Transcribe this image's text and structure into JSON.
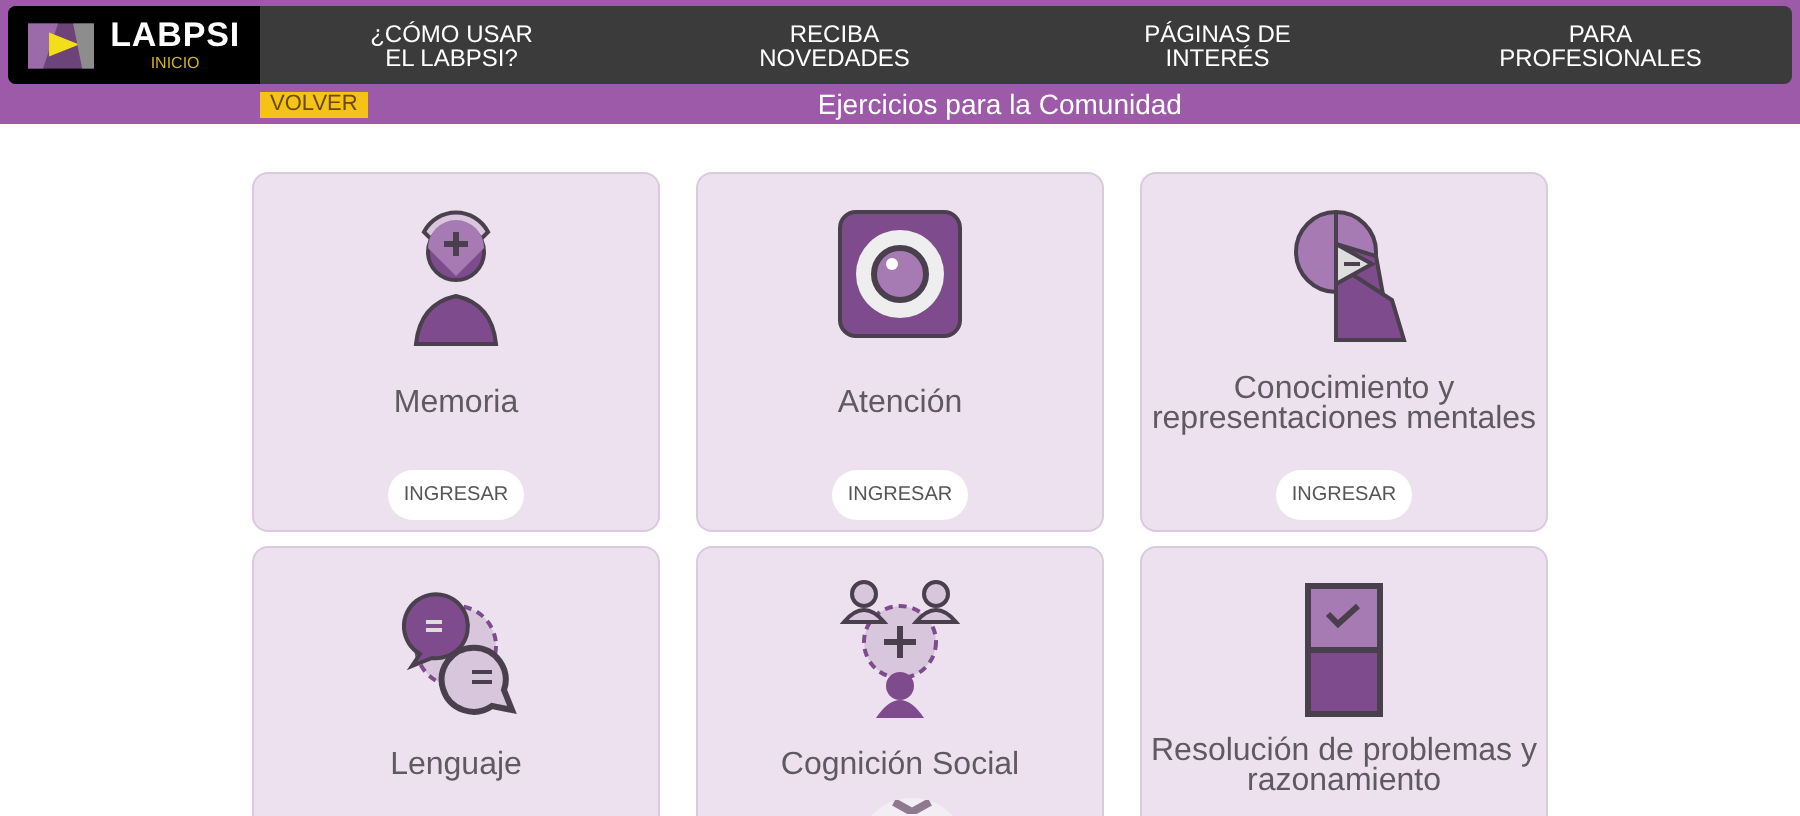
{
  "header": {
    "logo": {
      "title": "LABPSI",
      "subtitle": "INICIO"
    },
    "nav": [
      {
        "label": "¿CÓMO USAR\nEL LABPSI?"
      },
      {
        "label": "RECIBA\nNOVEDADES"
      },
      {
        "label": "PÁGINAS DE\nINTERÉS"
      },
      {
        "label": "PARA\nPROFESIONALES"
      }
    ],
    "back_button": "VOLVER",
    "page_title": "Ejercicios para la Comunidad"
  },
  "cards": [
    {
      "kind": "head",
      "title": "Memoria",
      "button": "INGRESAR"
    },
    {
      "kind": "eye",
      "title": "Atención",
      "button": "INGRESAR"
    },
    {
      "kind": "profile",
      "title": "Conocimiento y representaciones mentales",
      "button": "INGRESAR"
    },
    {
      "kind": "chat",
      "title": "Lenguaje"
    },
    {
      "kind": "people",
      "title": "Cognición Social"
    },
    {
      "kind": "puzzle",
      "title": "Resolución de problemas y razonamiento"
    }
  ]
}
